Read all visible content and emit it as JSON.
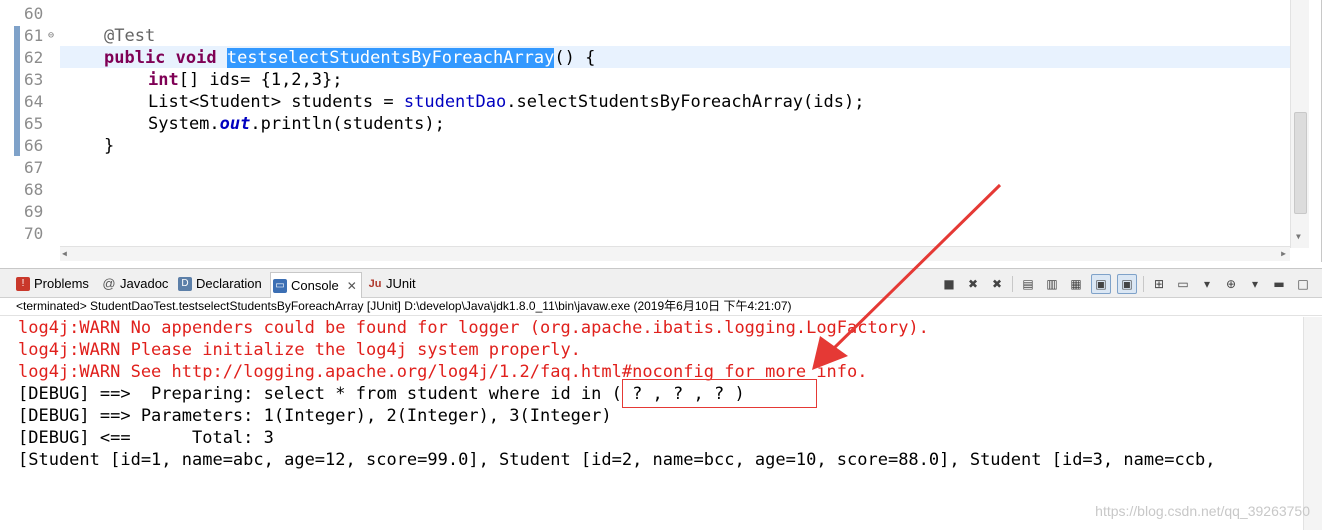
{
  "editor": {
    "line_numbers": [
      "60",
      "61",
      "62",
      "63",
      "64",
      "65",
      "66",
      "67",
      "68",
      "69",
      "70"
    ],
    "lines": {
      "l61_annotation": "@Test",
      "l62_kw1": "public",
      "l62_kw2": "void",
      "l62_method": "testselectStudentsByForeachArray",
      "l62_rest": "() {",
      "l63_kw": "int",
      "l63_rest": "[] ids= {1,2,3};",
      "l64_a": "List<Student> students = ",
      "l64_field": "studentDao",
      "l64_b": ".selectStudentsByForeachArray(ids);",
      "l65_a": "System.",
      "l65_static": "out",
      "l65_b": ".println(students);",
      "l66": "}"
    }
  },
  "views": {
    "tabs": [
      {
        "label": "Problems",
        "icon": "problems-icon",
        "active": false
      },
      {
        "label": "Javadoc",
        "icon": "javadoc-icon",
        "active": false
      },
      {
        "label": "Declaration",
        "icon": "declaration-icon",
        "active": false
      },
      {
        "label": "Console",
        "icon": "console-icon",
        "active": true,
        "close": "✕"
      },
      {
        "label": "JUnit",
        "icon": "junit-icon",
        "active": false
      }
    ],
    "console_title": "<terminated> StudentDaoTest.testselectStudentsByForeachArray [JUnit] D:\\develop\\Java\\jdk1.8.0_11\\bin\\javaw.exe (2019年6月10日 下午4:21:07)",
    "console_lines": [
      {
        "text": "log4j:WARN No appenders could be found for logger (org.apache.ibatis.logging.LogFactory).",
        "type": "err"
      },
      {
        "text": "log4j:WARN Please initialize the log4j system properly.",
        "type": "err"
      },
      {
        "text": "log4j:WARN See http://logging.apache.org/log4j/1.2/faq.html#noconfig for more info.",
        "type": "err"
      },
      {
        "text": "[DEBUG] ==>  Preparing: select * from student where id in ( ? , ? , ? )",
        "type": "out"
      },
      {
        "text": "[DEBUG] ==> Parameters: 1(Integer), 2(Integer), 3(Integer)",
        "type": "out"
      },
      {
        "text": "[DEBUG] <==      Total: 3",
        "type": "out"
      },
      {
        "text": "[Student [id=1, name=abc, age=12, score=99.0], Student [id=2, name=bcc, age=10, score=88.0], Student [id=3, name=ccb,",
        "type": "out"
      }
    ]
  },
  "watermark": "https://blog.csdn.net/qq_39263750",
  "colors": {
    "error": "#e0201c",
    "keyword": "#7f0055",
    "field": "#0000c0",
    "selection": "#3399ff",
    "annotation": "#e53935"
  }
}
